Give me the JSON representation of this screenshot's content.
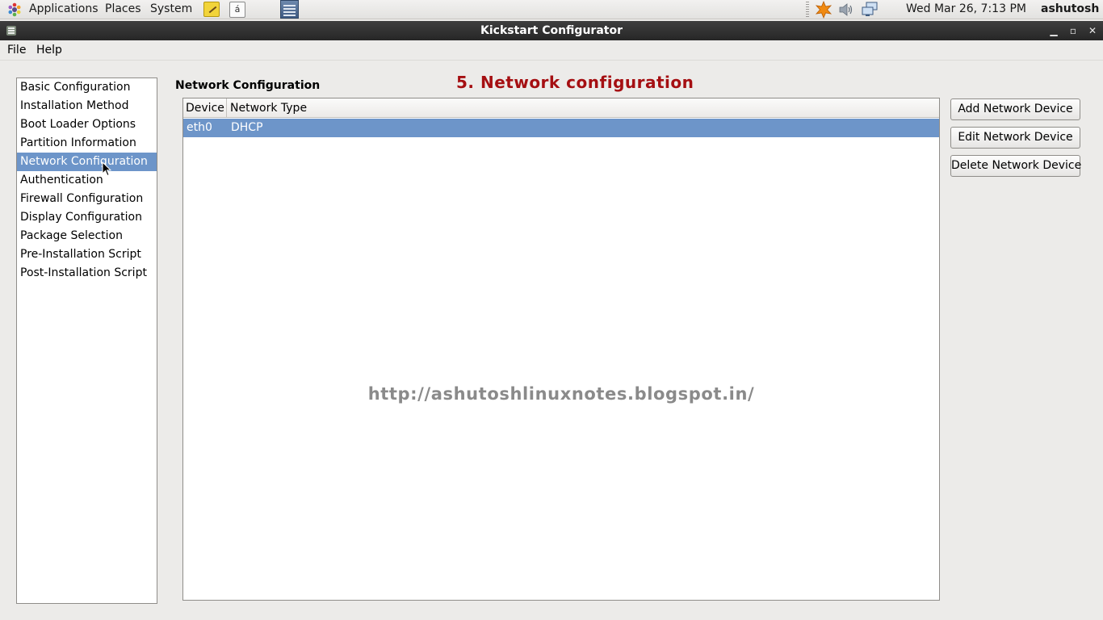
{
  "panel": {
    "applications_label": "Applications",
    "places_label": "Places",
    "system_label": "System",
    "char_icon_glyph": "á",
    "clock": "Wed Mar 26,  7:13 PM",
    "user": "ashutosh"
  },
  "window": {
    "title": "Kickstart Configurator",
    "minimize_glyph": "▁",
    "maximize_glyph": "▫",
    "close_glyph": "✕"
  },
  "menubar": {
    "file_label": "File",
    "help_label": "Help"
  },
  "sidebar": {
    "items": [
      {
        "label": "Basic Configuration"
      },
      {
        "label": "Installation Method"
      },
      {
        "label": "Boot Loader Options"
      },
      {
        "label": "Partition Information"
      },
      {
        "label": "Network Configuration",
        "selected": true
      },
      {
        "label": "Authentication"
      },
      {
        "label": "Firewall Configuration"
      },
      {
        "label": "Display Configuration"
      },
      {
        "label": "Package Selection"
      },
      {
        "label": "Pre-Installation Script"
      },
      {
        "label": "Post-Installation Script"
      }
    ]
  },
  "main": {
    "section_title": "Network Configuration",
    "annotation": "5. Network configuration",
    "table": {
      "columns": [
        "Device",
        "Network Type"
      ],
      "rows": [
        {
          "device": "eth0",
          "network_type": "DHCP",
          "selected": true
        }
      ]
    },
    "watermark": "http://ashutoshlinuxnotes.blogspot.in/"
  },
  "buttons": {
    "add": "Add Network Device",
    "edit": "Edit Network Device",
    "delete": "Delete Network Device"
  },
  "colors": {
    "selection": "#6d95c9",
    "annotation": "#a50f12",
    "titlebar": "#2f2f2f"
  }
}
